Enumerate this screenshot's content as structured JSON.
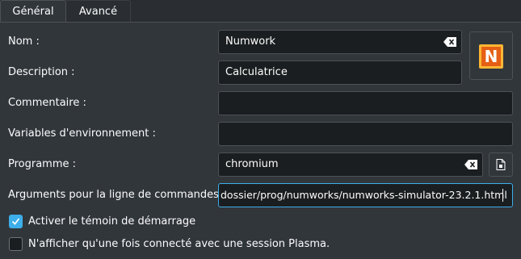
{
  "tabs": [
    {
      "label": "Général",
      "active": true
    },
    {
      "label": "Avancé",
      "active": false
    }
  ],
  "form": {
    "name": {
      "label": "Nom :",
      "value": "Numwork"
    },
    "description": {
      "label": "Description :",
      "value": "Calculatrice"
    },
    "comment": {
      "label": "Commentaire :",
      "value": ""
    },
    "env_vars": {
      "label": "Variables d'environnement :",
      "value": ""
    },
    "program": {
      "label": "Programme :",
      "value": "chromium"
    },
    "arguments": {
      "label": "Arguments pour la ligne de commandes :",
      "value": "dossier/prog/numworks/numworks-simulator-23.2.1.html"
    }
  },
  "icon": {
    "letter": "N",
    "name": "numworks-app-icon"
  },
  "options": {
    "startup_feedback": {
      "label": "Activer le témoin de démarrage",
      "checked": true
    },
    "plasma_only": {
      "label": "N'afficher qu'une fois connecté avec une session Plasma.",
      "checked": false
    }
  },
  "colors": {
    "background": "#31363b",
    "field_background": "#1b1e20",
    "accent": "#3daee9",
    "logo_orange": "#e55f14",
    "logo_yellow": "#ffb734"
  }
}
